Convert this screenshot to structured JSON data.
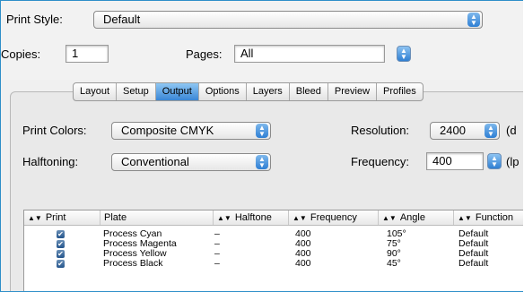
{
  "print_style": {
    "label": "Print Style:",
    "value": "Default"
  },
  "copies": {
    "label": "Copies:",
    "value": "1"
  },
  "pages": {
    "label": "Pages:",
    "value": "All"
  },
  "tabs": [
    {
      "label": "Layout"
    },
    {
      "label": "Setup"
    },
    {
      "label": "Output"
    },
    {
      "label": "Options"
    },
    {
      "label": "Layers"
    },
    {
      "label": "Bleed"
    },
    {
      "label": "Preview"
    },
    {
      "label": "Profiles"
    }
  ],
  "active_tab": "Output",
  "print_colors": {
    "label": "Print Colors:",
    "value": "Composite CMYK"
  },
  "halftoning": {
    "label": "Halftoning:",
    "value": "Conventional"
  },
  "resolution": {
    "label": "Resolution:",
    "value": "2400",
    "unit_partial": "(d"
  },
  "frequency": {
    "label": "Frequency:",
    "value": "400",
    "unit_partial": "(lp"
  },
  "table": {
    "headers": {
      "print": "Print",
      "plate": "Plate",
      "halftone": "Halftone",
      "frequency": "Frequency",
      "angle": "Angle",
      "function": "Function"
    },
    "rows": [
      {
        "print": true,
        "plate": "Process Cyan",
        "halftone": "–",
        "frequency": "400",
        "angle": "105°",
        "function": "Default"
      },
      {
        "print": true,
        "plate": "Process Magenta",
        "halftone": "–",
        "frequency": "400",
        "angle": "75°",
        "function": "Default"
      },
      {
        "print": true,
        "plate": "Process Yellow",
        "halftone": "–",
        "frequency": "400",
        "angle": "90°",
        "function": "Default"
      },
      {
        "print": true,
        "plate": "Process Black",
        "halftone": "–",
        "frequency": "400",
        "angle": "45°",
        "function": "Default"
      }
    ]
  },
  "colors": {
    "accent": "#3a86d6",
    "frame": "#2f8fc9"
  }
}
